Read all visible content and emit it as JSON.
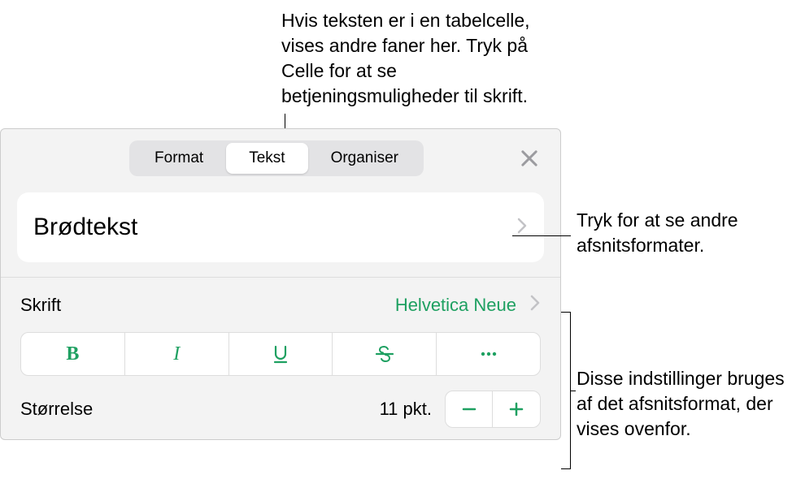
{
  "callouts": {
    "top": "Hvis teksten er i en tabelcelle, vises andre faner her. Tryk på Celle for at se betjeningsmuligheder til skrift.",
    "right1": "Tryk for at se andre afsnitsformater.",
    "right2": "Disse indstillinger bruges af det afsnitsformat, der vises ovenfor."
  },
  "tabs": {
    "format": "Format",
    "text": "Tekst",
    "organize": "Organiser"
  },
  "paragraph_style": {
    "label": "Brødtekst"
  },
  "font": {
    "label": "Skrift",
    "value": "Helvetica Neue"
  },
  "size": {
    "label": "Størrelse",
    "value": "11 pkt."
  },
  "accent_color": "#1ea061"
}
